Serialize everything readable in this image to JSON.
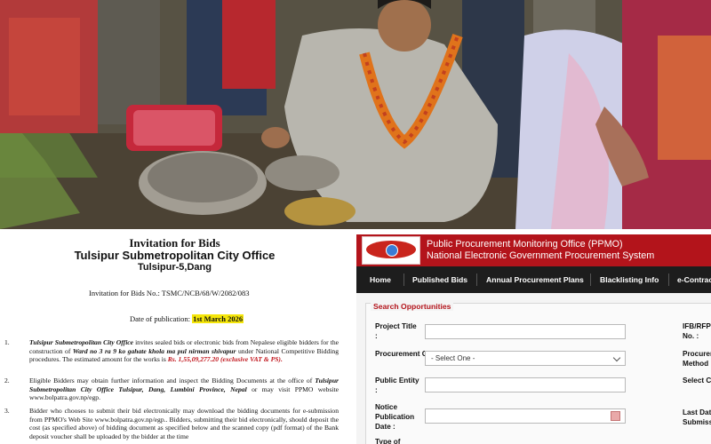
{
  "photo": {
    "description_icon": "photo-scene"
  },
  "document": {
    "title": "Invitation for Bids",
    "office": "Tulsipur Submetropolitan City Office",
    "address": "Tulsipur-5,Dang",
    "ref_label": "Invitation for Bids No.: TSMC/NCB/68/W/2082/083",
    "pub_label": "Date of publication: ",
    "pub_date": "1st March 2026",
    "items": [
      {
        "num": "1.",
        "pre": "",
        "bold1": "Tulsipur Submetropolitan City Office",
        "mid1": " invites sealed bids or electronic bids from Nepalese eligible bidders for the construction of ",
        "bold2": "Ward no 3 ra 9 ko gahate khola ma pul nirman shivapur",
        "mid2": " under National Competitive Bidding procedures. The estimated amount for the works is ",
        "red": "Rs. 1,55,09,277.20 (exclusive VAT & PS).",
        "post": ""
      },
      {
        "num": "2.",
        "text1": "Eligible Bidders may obtain further information and inspect the Bidding Documents at the office of ",
        "bold": "Tulsipur Submetropolitan City Office Tulsipur, Dang, Lumbini Province, Nepal",
        "text2": " or may visit PPMO website www.bolpatra.gov.np/egp."
      },
      {
        "num": "3.",
        "text": "Bidder who chooses to submit their bid electronically may download the bidding documents for e-submission from PPMO's Web Site www.bolpatra.gov.np/egp.. Bidders, submitting their bid electronically, should deposit the cost (as specified above) of bidding document as specified below and the scanned copy (pdf format) of the Bank deposit voucher shall be uploaded by the bidder at the time"
      }
    ]
  },
  "portal": {
    "header_line1": "Public Procurement Monitoring Office (PPMO)",
    "header_line2": "National Electronic Government Procurement System",
    "nav": [
      "Home",
      "Published Bids",
      "Annual Procurement Plans",
      "Blacklisting Info",
      "e-Contract"
    ],
    "search_title": "Search Opportunities",
    "fields": {
      "project_title_label": "Project Title",
      "project_title_value": "",
      "procurement_category_label": "Procurement Category :",
      "procurement_category_value": "- Select One -",
      "public_entity_label": "Public Entity",
      "public_entity_value": "",
      "notice_pub_date_label": "Notice Publication Date :",
      "notice_pub_date_value": "",
      "type_label": "Type of",
      "ifb_label": "IFB/RFP No. :",
      "procurement_method_label": "Procurement Method",
      "select_c_label": "Select C",
      "last_date_label": "Last Date Submission"
    },
    "colon": ":",
    "accent_color": "#b3141b",
    "nav_bg": "#1d1d1d"
  }
}
